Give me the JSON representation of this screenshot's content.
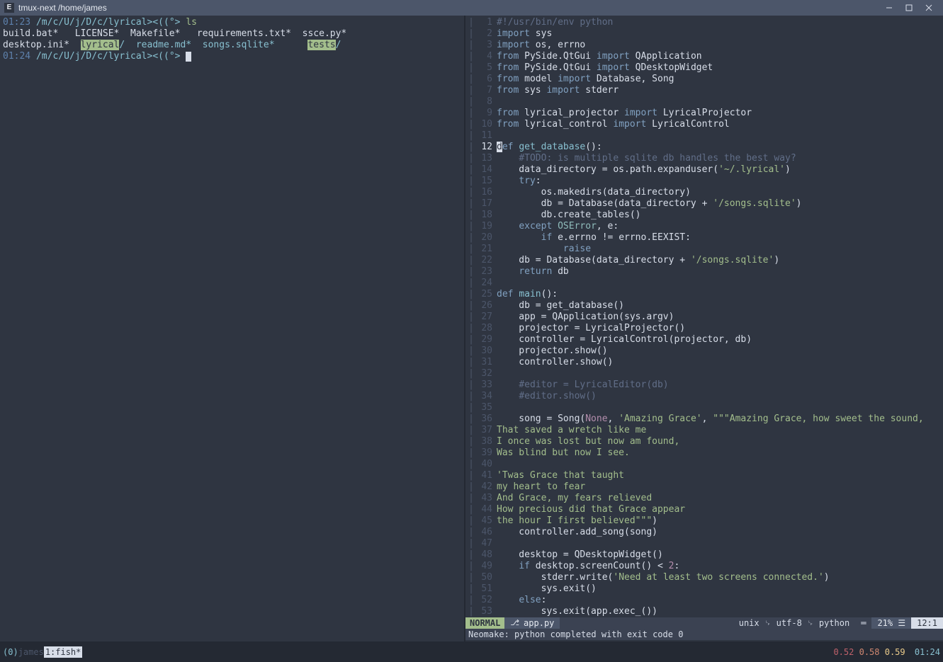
{
  "window": {
    "title": "tmux-next  /home/james"
  },
  "shell": {
    "prompt1_time": "01:23",
    "prompt1_path": " /m/c/U/j/D/c/lyrical",
    "prompt1_sym": "><((°> ",
    "cmd1": "ls",
    "ls_line1": "build.bat*   LICENSE*  Makefile*   requirements.txt*  ssce.py*",
    "ls_line2a": "desktop.ini*  ",
    "ls_dir_lyrical": "lyrical",
    "ls_line2b": "/  readme.md*  songs.sqlite*      ",
    "ls_dir_tests": "tests",
    "ls_line2c": "/",
    "prompt2_time": "01:24",
    "prompt2_path": " /m/c/U/j/D/c/lyrical",
    "prompt2_sym": "><((°>"
  },
  "code": [
    {
      "n": "1",
      "t": [
        [
          "#!/usr/bin/env python",
          "py-comment"
        ]
      ]
    },
    {
      "n": "2",
      "t": [
        [
          "import",
          "py-kw"
        ],
        [
          " sys",
          "py-ident"
        ]
      ]
    },
    {
      "n": "3",
      "t": [
        [
          "import",
          "py-kw"
        ],
        [
          " os, errno",
          "py-ident"
        ]
      ]
    },
    {
      "n": "4",
      "t": [
        [
          "from",
          "py-kw"
        ],
        [
          " PySide.QtGui ",
          "py-ident"
        ],
        [
          "import",
          "py-kw"
        ],
        [
          " QApplication",
          "py-ident"
        ]
      ]
    },
    {
      "n": "5",
      "t": [
        [
          "from",
          "py-kw"
        ],
        [
          " PySide.QtGui ",
          "py-ident"
        ],
        [
          "import",
          "py-kw"
        ],
        [
          " QDesktopWidget",
          "py-ident"
        ]
      ]
    },
    {
      "n": "6",
      "t": [
        [
          "from",
          "py-kw"
        ],
        [
          " model ",
          "py-ident"
        ],
        [
          "import",
          "py-kw"
        ],
        [
          " Database, Song",
          "py-ident"
        ]
      ]
    },
    {
      "n": "7",
      "t": [
        [
          "from",
          "py-kw"
        ],
        [
          " sys ",
          "py-ident"
        ],
        [
          "import",
          "py-kw"
        ],
        [
          " stderr",
          "py-ident"
        ]
      ]
    },
    {
      "n": "8",
      "t": [
        [
          "",
          ""
        ]
      ]
    },
    {
      "n": "9",
      "t": [
        [
          "from",
          "py-kw"
        ],
        [
          " lyrical_projector ",
          "py-ident"
        ],
        [
          "import",
          "py-kw"
        ],
        [
          " LyricalProjector",
          "py-ident"
        ]
      ]
    },
    {
      "n": "10",
      "t": [
        [
          "from",
          "py-kw"
        ],
        [
          " lyrical_control ",
          "py-ident"
        ],
        [
          "import",
          "py-kw"
        ],
        [
          " LyricalControl",
          "py-ident"
        ]
      ]
    },
    {
      "n": "11",
      "t": [
        [
          "",
          ""
        ]
      ]
    },
    {
      "n": "12",
      "cursor": true,
      "t": [
        [
          "d",
          "cursor-d"
        ],
        [
          "ef",
          "py-kw"
        ],
        [
          " ",
          "py-ident"
        ],
        [
          "get_database",
          "py-func"
        ],
        [
          "():",
          "py-ident"
        ]
      ]
    },
    {
      "n": "13",
      "t": [
        [
          "    ",
          ""
        ],
        [
          "#TODO: is multiple sqlite db handles the best way?",
          "py-comment"
        ]
      ]
    },
    {
      "n": "14",
      "t": [
        [
          "    data_directory = os.path.expanduser(",
          "py-ident"
        ],
        [
          "'~/.lyrical'",
          "py-str"
        ],
        [
          ")",
          "py-ident"
        ]
      ]
    },
    {
      "n": "15",
      "t": [
        [
          "    ",
          ""
        ],
        [
          "try",
          "py-kw"
        ],
        [
          ":",
          "py-ident"
        ]
      ]
    },
    {
      "n": "16",
      "t": [
        [
          "        os.makedirs(data_directory)",
          "py-ident"
        ]
      ]
    },
    {
      "n": "17",
      "t": [
        [
          "        db = Database(data_directory + ",
          "py-ident"
        ],
        [
          "'/songs.sqlite'",
          "py-str"
        ],
        [
          ")",
          "py-ident"
        ]
      ]
    },
    {
      "n": "18",
      "t": [
        [
          "        db.create_tables()",
          "py-ident"
        ]
      ]
    },
    {
      "n": "19",
      "t": [
        [
          "    ",
          ""
        ],
        [
          "except",
          "py-kw"
        ],
        [
          " ",
          "py-ident"
        ],
        [
          "OSError",
          "py-builtin"
        ],
        [
          ", e:",
          "py-ident"
        ]
      ]
    },
    {
      "n": "20",
      "t": [
        [
          "        ",
          ""
        ],
        [
          "if",
          "py-kw"
        ],
        [
          " e.errno != errno.EEXIST:",
          "py-ident"
        ]
      ]
    },
    {
      "n": "21",
      "t": [
        [
          "            ",
          ""
        ],
        [
          "raise",
          "py-kw"
        ]
      ]
    },
    {
      "n": "22",
      "t": [
        [
          "    db = Database(data_directory + ",
          "py-ident"
        ],
        [
          "'/songs.sqlite'",
          "py-str"
        ],
        [
          ")",
          "py-ident"
        ]
      ]
    },
    {
      "n": "23",
      "t": [
        [
          "    ",
          ""
        ],
        [
          "return",
          "py-kw"
        ],
        [
          " db",
          "py-ident"
        ]
      ]
    },
    {
      "n": "24",
      "t": [
        [
          "",
          ""
        ]
      ]
    },
    {
      "n": "25",
      "t": [
        [
          "def",
          "py-kw"
        ],
        [
          " ",
          ""
        ],
        [
          "main",
          "py-func"
        ],
        [
          "():",
          "py-ident"
        ]
      ]
    },
    {
      "n": "26",
      "t": [
        [
          "    db = get_database()",
          "py-ident"
        ]
      ]
    },
    {
      "n": "27",
      "t": [
        [
          "    app = QApplication(sys.argv)",
          "py-ident"
        ]
      ]
    },
    {
      "n": "28",
      "t": [
        [
          "    projector = LyricalProjector()",
          "py-ident"
        ]
      ]
    },
    {
      "n": "29",
      "t": [
        [
          "    controller = LyricalControl(projector, db)",
          "py-ident"
        ]
      ]
    },
    {
      "n": "30",
      "t": [
        [
          "    projector.show()",
          "py-ident"
        ]
      ]
    },
    {
      "n": "31",
      "t": [
        [
          "    controller.show()",
          "py-ident"
        ]
      ]
    },
    {
      "n": "32",
      "t": [
        [
          "",
          ""
        ]
      ]
    },
    {
      "n": "33",
      "t": [
        [
          "    ",
          ""
        ],
        [
          "#editor = LyricalEditor(db)",
          "py-comment"
        ]
      ]
    },
    {
      "n": "34",
      "t": [
        [
          "    ",
          ""
        ],
        [
          "#editor.show()",
          "py-comment"
        ]
      ]
    },
    {
      "n": "35",
      "t": [
        [
          "",
          ""
        ]
      ]
    },
    {
      "n": "36",
      "t": [
        [
          "    song = Song(",
          "py-ident"
        ],
        [
          "None",
          "py-none"
        ],
        [
          ", ",
          "py-ident"
        ],
        [
          "'Amazing Grace'",
          "py-str"
        ],
        [
          ", ",
          "py-ident"
        ],
        [
          "\"\"\"Amazing Grace, how sweet the sound,",
          "py-str"
        ]
      ]
    },
    {
      "n": "37",
      "t": [
        [
          "That saved a wretch like me",
          "py-str"
        ]
      ]
    },
    {
      "n": "38",
      "t": [
        [
          "I once was lost but now am found,",
          "py-str"
        ]
      ]
    },
    {
      "n": "39",
      "t": [
        [
          "Was blind but now I see.",
          "py-str"
        ]
      ]
    },
    {
      "n": "40",
      "t": [
        [
          "",
          "py-str"
        ]
      ]
    },
    {
      "n": "41",
      "t": [
        [
          "'Twas Grace that taught",
          "py-str"
        ]
      ]
    },
    {
      "n": "42",
      "t": [
        [
          "my heart to fear",
          "py-str"
        ]
      ]
    },
    {
      "n": "43",
      "t": [
        [
          "And Grace, my fears relieved",
          "py-str"
        ]
      ]
    },
    {
      "n": "44",
      "t": [
        [
          "How precious did that Grace appear",
          "py-str"
        ]
      ]
    },
    {
      "n": "45",
      "t": [
        [
          "the hour I first believed\"\"\"",
          "py-str"
        ],
        [
          ")",
          "py-ident"
        ]
      ]
    },
    {
      "n": "46",
      "t": [
        [
          "    controller.add_song(song)",
          "py-ident"
        ]
      ]
    },
    {
      "n": "47",
      "t": [
        [
          "",
          ""
        ]
      ]
    },
    {
      "n": "48",
      "t": [
        [
          "    desktop = QDesktopWidget()",
          "py-ident"
        ]
      ]
    },
    {
      "n": "49",
      "t": [
        [
          "    ",
          ""
        ],
        [
          "if",
          "py-kw"
        ],
        [
          " desktop.screenCount() < ",
          "py-ident"
        ],
        [
          "2",
          "py-num"
        ],
        [
          ":",
          "py-ident"
        ]
      ]
    },
    {
      "n": "50",
      "t": [
        [
          "        stderr.write(",
          "py-ident"
        ],
        [
          "'Need at least two screens connected.'",
          "py-str"
        ],
        [
          ")",
          "py-ident"
        ]
      ]
    },
    {
      "n": "51",
      "t": [
        [
          "        sys.exit()",
          "py-ident"
        ]
      ]
    },
    {
      "n": "52",
      "t": [
        [
          "    ",
          ""
        ],
        [
          "else",
          "py-kw"
        ],
        [
          ":",
          "py-ident"
        ]
      ]
    },
    {
      "n": "53",
      "t": [
        [
          "        sys.exit(app.exec_())",
          "py-ident"
        ]
      ]
    }
  ],
  "status": {
    "mode": "NORMAL",
    "file": "app.py",
    "info": "unix ␊ utf-8 ␊ python",
    "scrollbar": "═",
    "pct": "21% ☰",
    "pos": "12:1",
    "neomake": "Neomake: python completed with exit code 0"
  },
  "tmux": {
    "session": "(0)",
    "user": " james",
    "window": "1:fish*",
    "load1": "0.52",
    "load2": "0.58",
    "load3": "0.59",
    "clock": "01:24"
  }
}
